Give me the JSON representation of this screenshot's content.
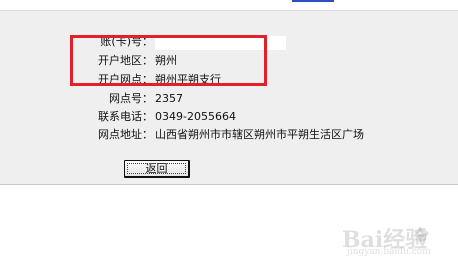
{
  "form": {
    "account_label": "账(卡)号：",
    "account_value": "",
    "region_label": "开户地区：",
    "region_value": "朔州",
    "branch_label": "开户网点：",
    "branch_value": "朔州平朔支行",
    "branch_no_label": "网点号：",
    "branch_no_value": "2357",
    "phone_label": "联系电话：",
    "phone_value": "0349-2055664",
    "address_label": "网点地址：",
    "address_value": "山西省朔州市市辖区朔州市平朔生活区广场"
  },
  "actions": {
    "back_label": "返回"
  },
  "watermark": {
    "main": "Bai经验",
    "sub": "jingyan.baidu.com"
  },
  "colors": {
    "panel_background": "#efefef",
    "highlight_border": "#e0202a",
    "top_link": "#2a4fbf"
  }
}
